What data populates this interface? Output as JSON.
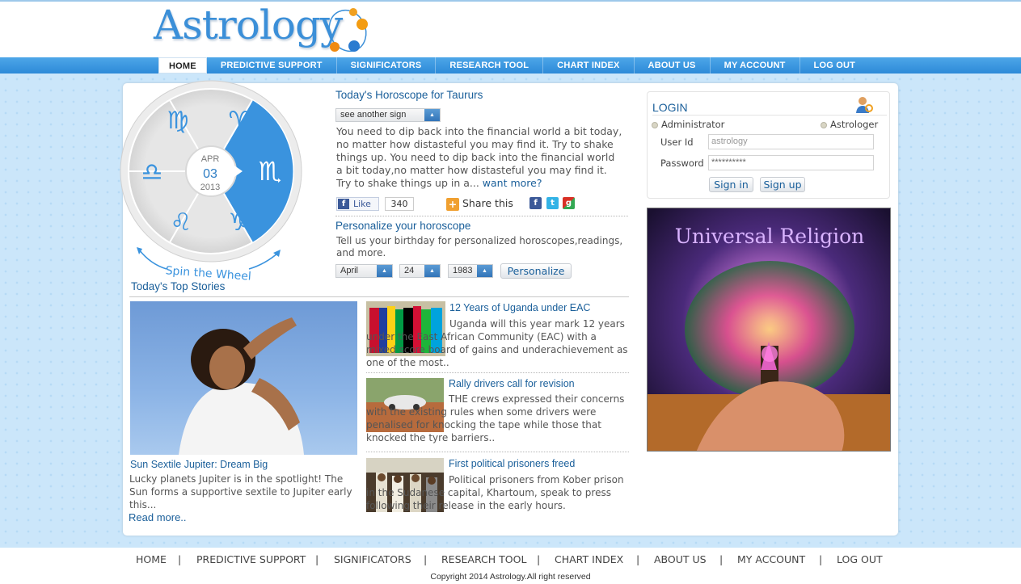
{
  "brand": {
    "logo_text": "Astrology"
  },
  "nav": {
    "items": [
      "HOME",
      "PREDICTIVE SUPPORT",
      "SIGNIFICATORS",
      "RESEARCH TOOL",
      "CHART INDEX",
      "ABOUT US",
      "MY ACCOUNT",
      "LOG OUT"
    ],
    "active": "HOME"
  },
  "wheel": {
    "month": "APR",
    "day": "03",
    "year": "2013",
    "spin_label": "Spin the Wheel",
    "active_sign": "scorpio-icon"
  },
  "horoscope": {
    "title": "Today's Horoscope for Taururs",
    "sign_select": "see another sign",
    "text": "You need to dip back into the financial world a bit today, no matter how distasteful you may find it. Try to shake things up. You need to dip back into the financial world a bit today,no matter how distasteful you may find it. Try to shake things up in a...",
    "more_link": "want more?",
    "like_label": "Like",
    "like_count": "340",
    "share_label": "Share this"
  },
  "personalize": {
    "title": "Personalize your horoscope",
    "text": "Tell us your birthday for personalized horoscopes,readings, and more.",
    "month": "April",
    "day": "24",
    "year": "1983",
    "button": "Personalize"
  },
  "top_stories": {
    "title": "Today's Top Stories",
    "feature": {
      "headline": "Sun Sextile Jupiter: Dream Big",
      "text": "Lucky planets Jupiter is in the spotlight! The Sun forms a supportive sextile to Jupiter early this...",
      "more": "Read more.."
    },
    "items": [
      {
        "headline": "12 Years of Uganda under EAC",
        "text": "Uganda will this year mark 12 years under the East African Community (EAC) with a mixed score board of gains and underachievement as one of the most.."
      },
      {
        "headline": "Rally drivers call for revision",
        "text": "THE crews expressed their concerns with the existing rules when some drivers were penalised for knocking the tape while those that knocked the tyre barriers.."
      },
      {
        "headline": "First political prisoners freed",
        "text": "Political prisoners from Kober prison in the Sudanese capital, Khartoum, speak to press following their release in the early hours."
      }
    ]
  },
  "login": {
    "title": "LOGIN",
    "role_admin": "Administrator",
    "role_astro": "Astrologer",
    "user_label": "User Id",
    "user_value": "astrology",
    "pass_label": "Password",
    "pass_value": "**********",
    "signin": "Sign in",
    "signup": "Sign up"
  },
  "ad": {
    "title": "Universal Religion"
  },
  "footer": {
    "links": [
      "HOME",
      "PREDICTIVE SUPPORT",
      "SIGNIFICATORS",
      "RESEARCH TOOL",
      "CHART INDEX",
      "ABOUT US",
      "MY ACCOUNT",
      "LOG OUT"
    ],
    "copyright": "Copyright 2014 Astrology.All right reserved"
  },
  "colors": {
    "accent": "#2d8ad8",
    "link": "#1a5f9a",
    "background": "#cbe6fa"
  }
}
